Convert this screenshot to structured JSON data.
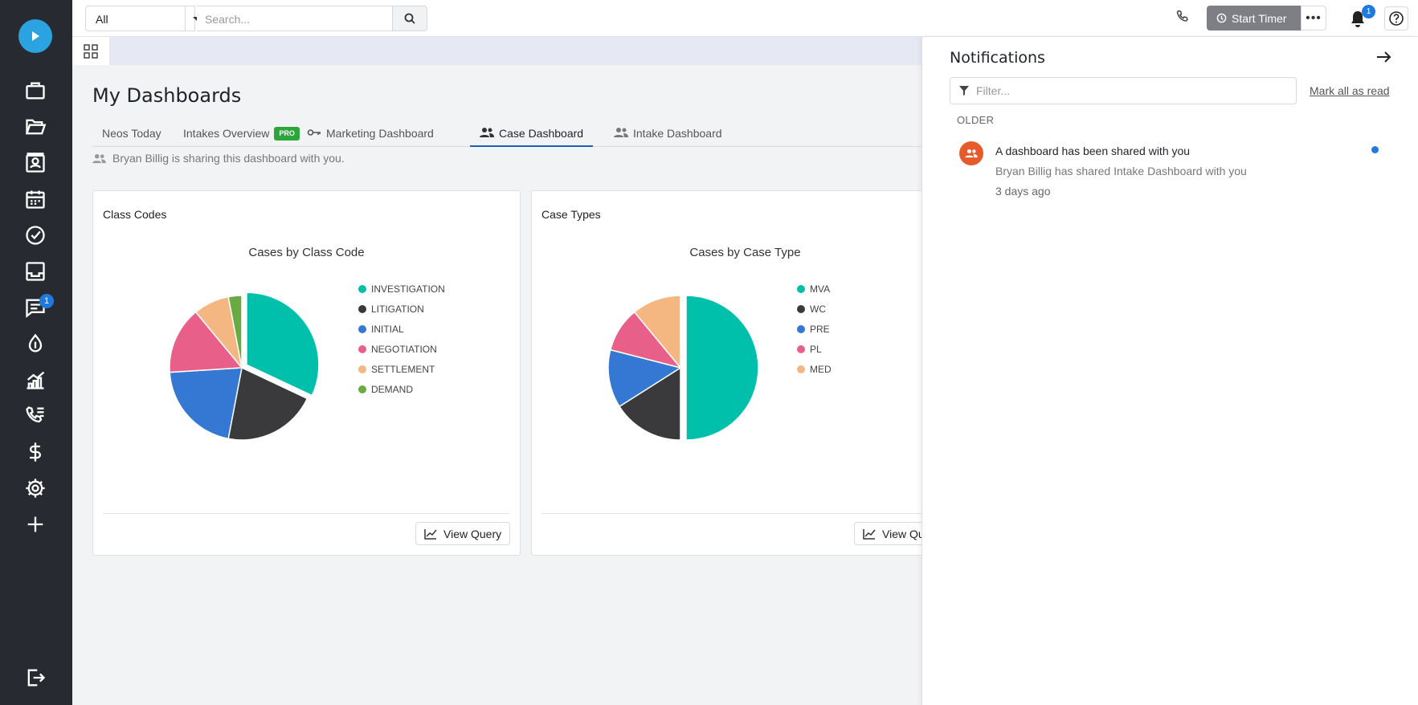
{
  "sidebar": {
    "items": [
      "logo-play",
      "cases",
      "folders",
      "contacts",
      "calendar",
      "tasks",
      "inbox",
      "messages",
      "intakes",
      "reports",
      "calls",
      "billing",
      "settings",
      "add",
      "logout"
    ],
    "messages_badge": "1"
  },
  "topbar": {
    "scope_value": "All",
    "search_placeholder": "Search...",
    "start_timer_label": "Start Timer",
    "more_label": "•••",
    "notifications_badge": "1"
  },
  "page": {
    "title": "My Dashboards",
    "tabs": [
      {
        "label": "Neos Today"
      },
      {
        "label": "Intakes Overview",
        "badge": "PRO"
      },
      {
        "label": "Marketing Dashboard"
      },
      {
        "label": "Case Dashboard",
        "active": true
      },
      {
        "label": "Intake Dashboard"
      }
    ],
    "share_note": "Bryan Billig is sharing this dashboard with you."
  },
  "cards": [
    {
      "title": "Class Codes",
      "chart_title": "Cases by Class Code",
      "view_label": "View Query"
    },
    {
      "title": "Case Types",
      "chart_title": "Cases by Case Type",
      "view_label": "View Query"
    }
  ],
  "chart_data": [
    {
      "type": "pie",
      "title": "Cases by Class Code",
      "labels": [
        "INVESTIGATION",
        "LITIGATION",
        "INITIAL",
        "NEGOTIATION",
        "SETTLEMENT",
        "DEMAND"
      ],
      "values": [
        32,
        21,
        21,
        15,
        8,
        3
      ],
      "colors": [
        "#00bfab",
        "#3a3a3c",
        "#3578d4",
        "#e8608a",
        "#f4b782",
        "#69aa43"
      ]
    },
    {
      "type": "pie",
      "title": "Cases by Case Type",
      "labels": [
        "MVA",
        "WC",
        "PRE",
        "PL",
        "MED"
      ],
      "values": [
        50,
        16,
        13,
        10,
        11
      ],
      "colors": [
        "#00bfab",
        "#3a3a3c",
        "#3578d4",
        "#e8608a",
        "#f4b782"
      ]
    }
  ],
  "notifications": {
    "title": "Notifications",
    "filter_placeholder": "Filter...",
    "mark_all_label": "Mark all as read",
    "section_label": "OLDER",
    "items": [
      {
        "title": "A dashboard has been shared with you",
        "body": "Bryan Billig has shared Intake Dashboard with you",
        "time": "3 days ago",
        "unread": true
      }
    ]
  }
}
